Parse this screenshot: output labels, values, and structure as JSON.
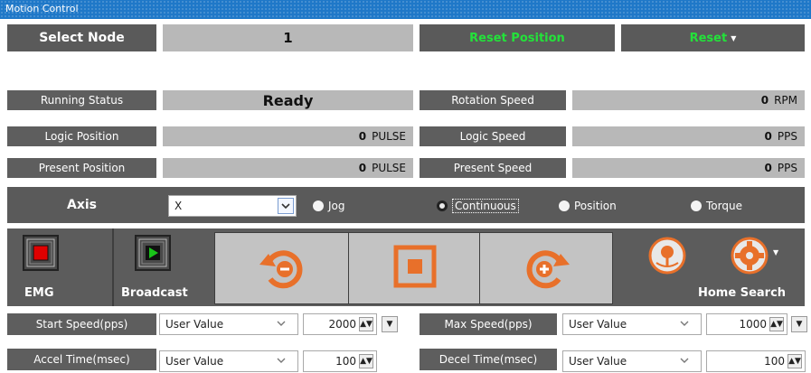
{
  "title": "Motion Control",
  "select_node": {
    "label": "Select Node",
    "value": "1"
  },
  "reset_position_label": "Reset Position",
  "reset_label": "Reset",
  "status": {
    "running_status_label": "Running Status",
    "running_status_value": "Ready",
    "logic_position_label": "Logic Position",
    "logic_position_value": "0",
    "logic_position_unit": "PULSE",
    "present_position_label": "Present Position",
    "present_position_value": "0",
    "present_position_unit": "PULSE",
    "rotation_speed_label": "Rotation Speed",
    "rotation_speed_value": "0",
    "rotation_speed_unit": "RPM",
    "logic_speed_label": "Logic Speed",
    "logic_speed_value": "0",
    "logic_speed_unit": "PPS",
    "present_speed_label": "Present Speed",
    "present_speed_value": "0",
    "present_speed_unit": "PPS"
  },
  "axis": {
    "label": "Axis",
    "value": "X",
    "modes": [
      "Jog",
      "Continuous",
      "Position",
      "Torque"
    ],
    "selected_mode": "Continuous"
  },
  "buttons": {
    "emg_label": "EMG",
    "broadcast_label": "Broadcast",
    "home_search_label": "Home Search"
  },
  "params": {
    "start_speed_label": "Start Speed(pps)",
    "start_speed_source": "User Value",
    "start_speed_value": "2000",
    "max_speed_label": "Max Speed(pps)",
    "max_speed_source": "User Value",
    "max_speed_value": "1000",
    "accel_time_label": "Accel Time(msec)",
    "accel_time_source": "User Value",
    "accel_time_value": "100",
    "decel_time_label": "Decel Time(msec)",
    "decel_time_source": "User Value",
    "decel_time_value": "100"
  },
  "colors": {
    "title_bar": "#1f78c8",
    "accent_green": "#23e23a",
    "icon_orange": "#e8702a",
    "emg_red": "#e00000",
    "broadcast_green": "#19c419"
  }
}
